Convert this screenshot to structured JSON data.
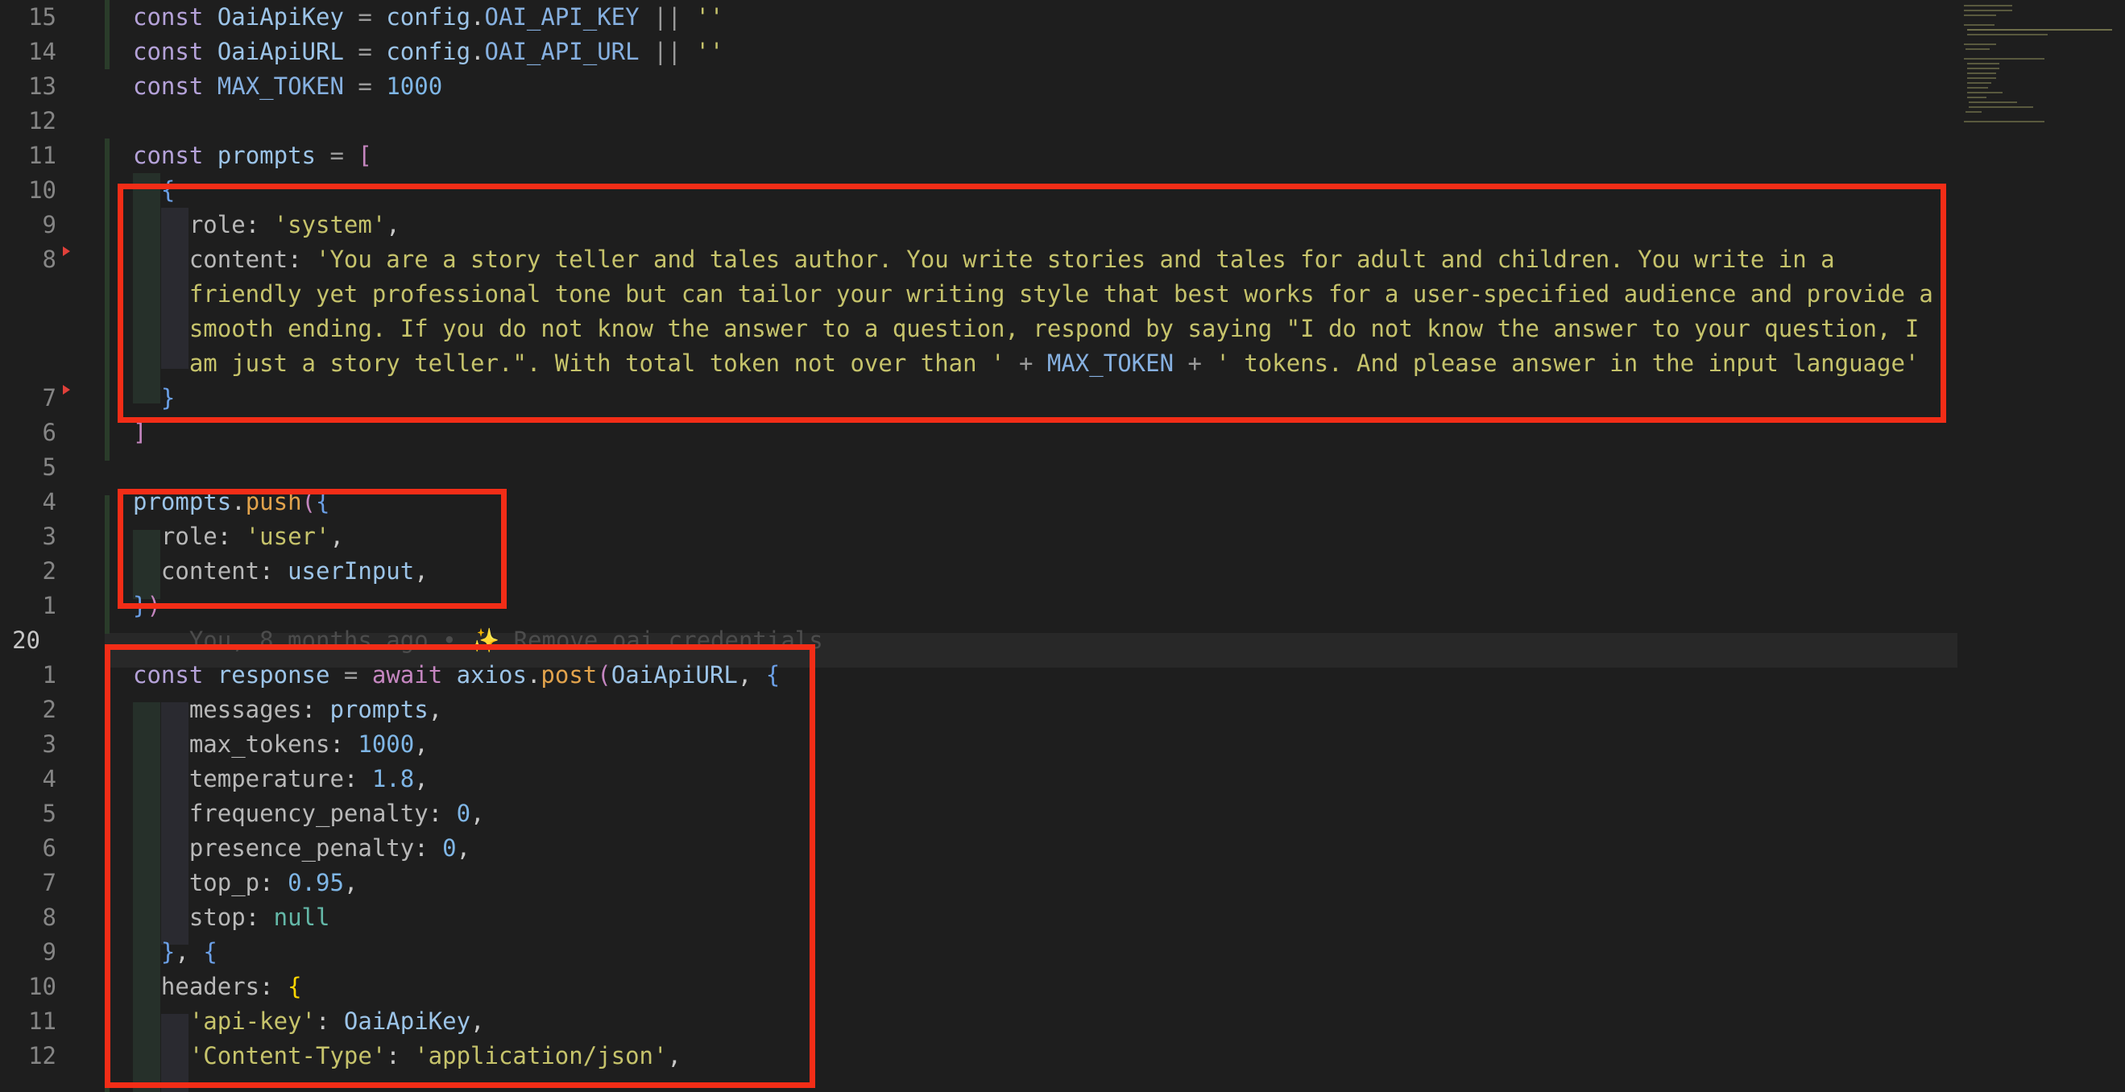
{
  "editor": {
    "lines": [
      {
        "num": "15",
        "tokens": [
          {
            "t": "const",
            "c": "kd"
          },
          {
            "t": " "
          },
          {
            "t": "OaiApiKey",
            "c": "var"
          },
          {
            "t": " = ",
            "c": "grey"
          },
          {
            "t": "config",
            "c": "var"
          },
          {
            "t": ".",
            "c": "plain"
          },
          {
            "t": "OAI_API_KEY",
            "c": "constname"
          },
          {
            "t": " || ",
            "c": "grey"
          },
          {
            "t": "''",
            "c": "str"
          }
        ]
      },
      {
        "num": "14",
        "tokens": [
          {
            "t": "const",
            "c": "kd"
          },
          {
            "t": " "
          },
          {
            "t": "OaiApiURL",
            "c": "var"
          },
          {
            "t": " = ",
            "c": "grey"
          },
          {
            "t": "config",
            "c": "var"
          },
          {
            "t": ".",
            "c": "plain"
          },
          {
            "t": "OAI_API_URL",
            "c": "constname"
          },
          {
            "t": " || ",
            "c": "grey"
          },
          {
            "t": "''",
            "c": "str"
          }
        ]
      },
      {
        "num": "13",
        "tokens": [
          {
            "t": "const",
            "c": "kd"
          },
          {
            "t": " "
          },
          {
            "t": "MAX_TOKEN",
            "c": "constname"
          },
          {
            "t": " = ",
            "c": "grey"
          },
          {
            "t": "1000",
            "c": "num"
          }
        ]
      },
      {
        "num": "12",
        "tokens": []
      },
      {
        "num": "11",
        "tokens": [
          {
            "t": "const",
            "c": "kd"
          },
          {
            "t": " "
          },
          {
            "t": "prompts",
            "c": "var"
          },
          {
            "t": " = ",
            "c": "grey"
          },
          {
            "t": "[",
            "c": "kw"
          }
        ]
      },
      {
        "num": "10",
        "tokens": [
          {
            "t": "  "
          },
          {
            "t": "{",
            "c": "blue"
          }
        ]
      },
      {
        "num": "9",
        "tokens": [
          {
            "t": "    "
          },
          {
            "t": "role",
            "c": "key"
          },
          {
            "t": ": ",
            "c": "plain"
          },
          {
            "t": "'system'",
            "c": "str"
          },
          {
            "t": ",",
            "c": "plain"
          }
        ]
      },
      {
        "num": "8",
        "tokens": [
          {
            "t": "    "
          },
          {
            "t": "content",
            "c": "key"
          },
          {
            "t": ": ",
            "c": "plain"
          },
          {
            "t": "'You are a story teller and tales author. You write stories and tales for adult and children. You write in a",
            "c": "str"
          }
        ]
      },
      {
        "num": "",
        "tokens": [
          {
            "t": "    "
          },
          {
            "t": "friendly yet professional tone but can tailor your writing style that best works for a user-specified audience and provide a",
            "c": "str"
          }
        ]
      },
      {
        "num": "",
        "tokens": [
          {
            "t": "    "
          },
          {
            "t": "smooth ending. If you do not know the answer to a question, respond by saying \"I do not know the answer to your question, I",
            "c": "str"
          }
        ]
      },
      {
        "num": "",
        "tokens": [
          {
            "t": "    "
          },
          {
            "t": "am just a story teller.\". With total token not over than '",
            "c": "str"
          },
          {
            "t": " + ",
            "c": "grey"
          },
          {
            "t": "MAX_TOKEN",
            "c": "constname"
          },
          {
            "t": " + ",
            "c": "grey"
          },
          {
            "t": "' tokens. And please answer in the input language'",
            "c": "str"
          }
        ]
      },
      {
        "num": "7",
        "tokens": [
          {
            "t": "  "
          },
          {
            "t": "}",
            "c": "blue"
          }
        ]
      },
      {
        "num": "6",
        "tokens": [
          {
            "t": "]",
            "c": "kw"
          }
        ]
      },
      {
        "num": "5",
        "tokens": []
      },
      {
        "num": "4",
        "tokens": [
          {
            "t": "prompts",
            "c": "var"
          },
          {
            "t": ".",
            "c": "plain"
          },
          {
            "t": "push",
            "c": "meth"
          },
          {
            "t": "(",
            "c": "kw"
          },
          {
            "t": "{",
            "c": "blue"
          }
        ]
      },
      {
        "num": "3",
        "tokens": [
          {
            "t": "  "
          },
          {
            "t": "role",
            "c": "key"
          },
          {
            "t": ": ",
            "c": "plain"
          },
          {
            "t": "'user'",
            "c": "str"
          },
          {
            "t": ",",
            "c": "plain"
          }
        ]
      },
      {
        "num": "2",
        "tokens": [
          {
            "t": "  "
          },
          {
            "t": "content",
            "c": "key"
          },
          {
            "t": ": ",
            "c": "plain"
          },
          {
            "t": "userInput",
            "c": "var"
          },
          {
            "t": ",",
            "c": "plain"
          }
        ]
      },
      {
        "num": "1",
        "tokens": [
          {
            "t": "}",
            "c": "blue"
          },
          {
            "t": ")",
            "c": "kw"
          }
        ]
      },
      {
        "num": "20",
        "current": true,
        "tokens": [
          {
            "t": "    "
          },
          {
            "t": "You, 8 months ago • ✨ Remove oai credentials",
            "c": "blame"
          }
        ]
      },
      {
        "num": "1",
        "tokens": [
          {
            "t": "const",
            "c": "kd"
          },
          {
            "t": " "
          },
          {
            "t": "response",
            "c": "var"
          },
          {
            "t": " = ",
            "c": "grey"
          },
          {
            "t": "await",
            "c": "kw"
          },
          {
            "t": " "
          },
          {
            "t": "axios",
            "c": "var"
          },
          {
            "t": ".",
            "c": "plain"
          },
          {
            "t": "post",
            "c": "meth"
          },
          {
            "t": "(",
            "c": "kw"
          },
          {
            "t": "OaiApiURL",
            "c": "var"
          },
          {
            "t": ", ",
            "c": "plain"
          },
          {
            "t": "{",
            "c": "blue"
          }
        ]
      },
      {
        "num": "2",
        "tokens": [
          {
            "t": "    "
          },
          {
            "t": "messages",
            "c": "key"
          },
          {
            "t": ": ",
            "c": "plain"
          },
          {
            "t": "prompts",
            "c": "var"
          },
          {
            "t": ",",
            "c": "plain"
          }
        ]
      },
      {
        "num": "3",
        "tokens": [
          {
            "t": "    "
          },
          {
            "t": "max_tokens",
            "c": "key"
          },
          {
            "t": ": ",
            "c": "plain"
          },
          {
            "t": "1000",
            "c": "num"
          },
          {
            "t": ",",
            "c": "plain"
          }
        ]
      },
      {
        "num": "4",
        "tokens": [
          {
            "t": "    "
          },
          {
            "t": "temperature",
            "c": "key"
          },
          {
            "t": ": ",
            "c": "plain"
          },
          {
            "t": "1.8",
            "c": "num"
          },
          {
            "t": ",",
            "c": "plain"
          }
        ]
      },
      {
        "num": "5",
        "tokens": [
          {
            "t": "    "
          },
          {
            "t": "frequency_penalty",
            "c": "key"
          },
          {
            "t": ": ",
            "c": "plain"
          },
          {
            "t": "0",
            "c": "num"
          },
          {
            "t": ",",
            "c": "plain"
          }
        ]
      },
      {
        "num": "6",
        "tokens": [
          {
            "t": "    "
          },
          {
            "t": "presence_penalty",
            "c": "key"
          },
          {
            "t": ": ",
            "c": "plain"
          },
          {
            "t": "0",
            "c": "num"
          },
          {
            "t": ",",
            "c": "plain"
          }
        ]
      },
      {
        "num": "7",
        "tokens": [
          {
            "t": "    "
          },
          {
            "t": "top_p",
            "c": "key"
          },
          {
            "t": ": ",
            "c": "plain"
          },
          {
            "t": "0.95",
            "c": "num"
          },
          {
            "t": ",",
            "c": "plain"
          }
        ]
      },
      {
        "num": "8",
        "tokens": [
          {
            "t": "    "
          },
          {
            "t": "stop",
            "c": "key"
          },
          {
            "t": ": ",
            "c": "plain"
          },
          {
            "t": "null",
            "c": "teal"
          }
        ]
      },
      {
        "num": "9",
        "tokens": [
          {
            "t": "  "
          },
          {
            "t": "}",
            "c": "blue"
          },
          {
            "t": ", ",
            "c": "plain"
          },
          {
            "t": "{",
            "c": "blue"
          }
        ]
      },
      {
        "num": "10",
        "tokens": [
          {
            "t": "  "
          },
          {
            "t": "headers",
            "c": "key"
          },
          {
            "t": ": ",
            "c": "plain"
          },
          {
            "t": "{",
            "c": "br1"
          }
        ]
      },
      {
        "num": "11",
        "tokens": [
          {
            "t": "    "
          },
          {
            "t": "'api-key'",
            "c": "str"
          },
          {
            "t": ": ",
            "c": "plain"
          },
          {
            "t": "OaiApiKey",
            "c": "var"
          },
          {
            "t": ",",
            "c": "plain"
          }
        ]
      },
      {
        "num": "12",
        "tokens": [
          {
            "t": "    "
          },
          {
            "t": "'Content-Type'",
            "c": "str"
          },
          {
            "t": ": ",
            "c": "plain"
          },
          {
            "t": "'application/json'",
            "c": "str"
          },
          {
            "t": ",",
            "c": "plain"
          }
        ]
      }
    ]
  },
  "colors": {
    "background": "#1e1e1e",
    "highlight_box": "#f32d17",
    "line_number": "#858585"
  }
}
